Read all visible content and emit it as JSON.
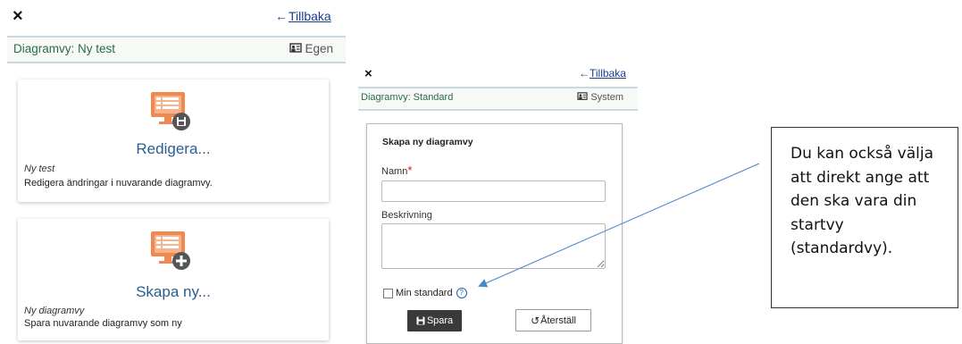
{
  "left_panel": {
    "close_symbol": "×",
    "back_link": "Tillbaka",
    "bar_title": "Diagramvy: Ny test",
    "bar_right": "Egen",
    "cards": [
      {
        "icon": "monitor-save-icon",
        "title": "Redigera...",
        "subtitle": "Ny test",
        "description": "Redigera ändringar i nuvarande diagramvy."
      },
      {
        "icon": "monitor-add-icon",
        "title": "Skapa ny...",
        "subtitle": "Ny diagramvy",
        "description": "Spara nuvarande diagramvy som ny"
      }
    ]
  },
  "middle_panel": {
    "close_symbol": "×",
    "back_link": "Tillbaka",
    "bar_title": "Diagramvy: Standard",
    "bar_right": "System",
    "form": {
      "title": "Skapa ny diagramvy",
      "name_label": "Namn",
      "required_marker": "*",
      "name_value": "",
      "description_label": "Beskrivning",
      "description_value": "",
      "checkbox_label": "Min standard",
      "save_button": "Spara",
      "reset_button": "Återställ"
    }
  },
  "callout": {
    "text_lines": [
      "Du kan också välja",
      "att direkt ange att",
      "den ska vara din",
      "startvy",
      "(standardvy)."
    ]
  },
  "colors": {
    "accent_green": "#2c6b48",
    "link_blue": "#1a3f8f",
    "icon_orange": "#f0894f",
    "card_title_blue": "#2a5e91",
    "annotation_arrow": "#4a86c8"
  }
}
